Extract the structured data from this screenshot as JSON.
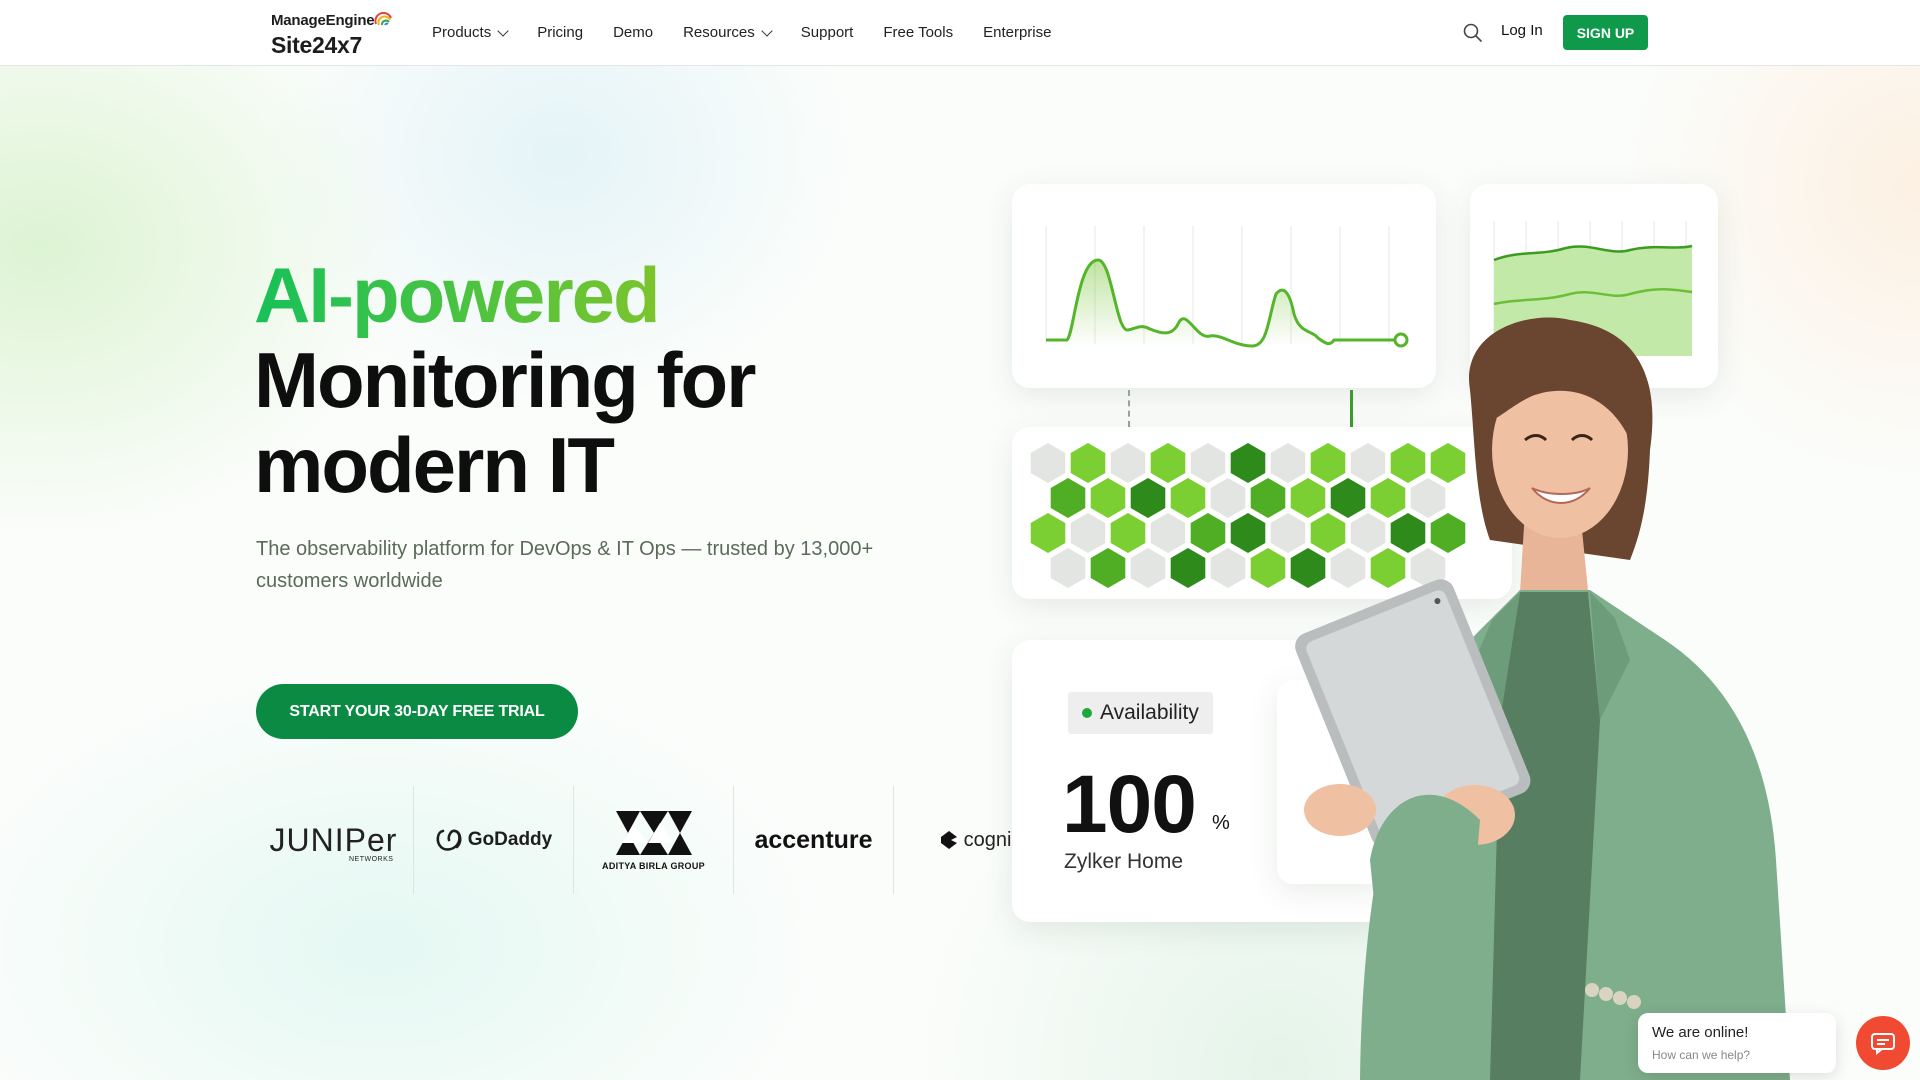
{
  "brand": {
    "top": "ManageEngine",
    "bottom": "Site24x7"
  },
  "nav": {
    "items": [
      {
        "label": "Products",
        "dropdown": true
      },
      {
        "label": "Pricing",
        "dropdown": false
      },
      {
        "label": "Demo",
        "dropdown": false
      },
      {
        "label": "Resources",
        "dropdown": true
      },
      {
        "label": "Support",
        "dropdown": false
      },
      {
        "label": "Free Tools",
        "dropdown": false
      },
      {
        "label": "Enterprise",
        "dropdown": false
      }
    ],
    "login": "Log In",
    "signup": "SIGN UP"
  },
  "hero": {
    "line1": "AI-powered",
    "line2": "Monitoring for",
    "line3": "modern IT",
    "subtitle": "The observability platform for DevOps & IT Ops — trusted by 13,000+ customers worldwide",
    "cta": "START YOUR 30-DAY FREE TRIAL"
  },
  "customers": {
    "juniper": "JUNIPer",
    "juniper_sub": "NETWORKS",
    "godaddy": "GoDaddy",
    "birla": "ADITYA BIRLA GROUP",
    "accenture": "accenture",
    "cogni": "cogni"
  },
  "availability": {
    "badge": "Availability",
    "value": "100",
    "unit": "%",
    "name": "Zylker Home"
  },
  "chat": {
    "title": "We are online!",
    "subtitle": "How can we help?"
  },
  "colors": {
    "brand_green": "#0f9a4b",
    "cta_green": "#0b8a44",
    "accent_green": "#6fc12a",
    "chat_orange": "#f04b32"
  },
  "icons": {
    "search": "search-icon",
    "chat": "chat-icon",
    "chevron": "chevron-down-icon"
  }
}
